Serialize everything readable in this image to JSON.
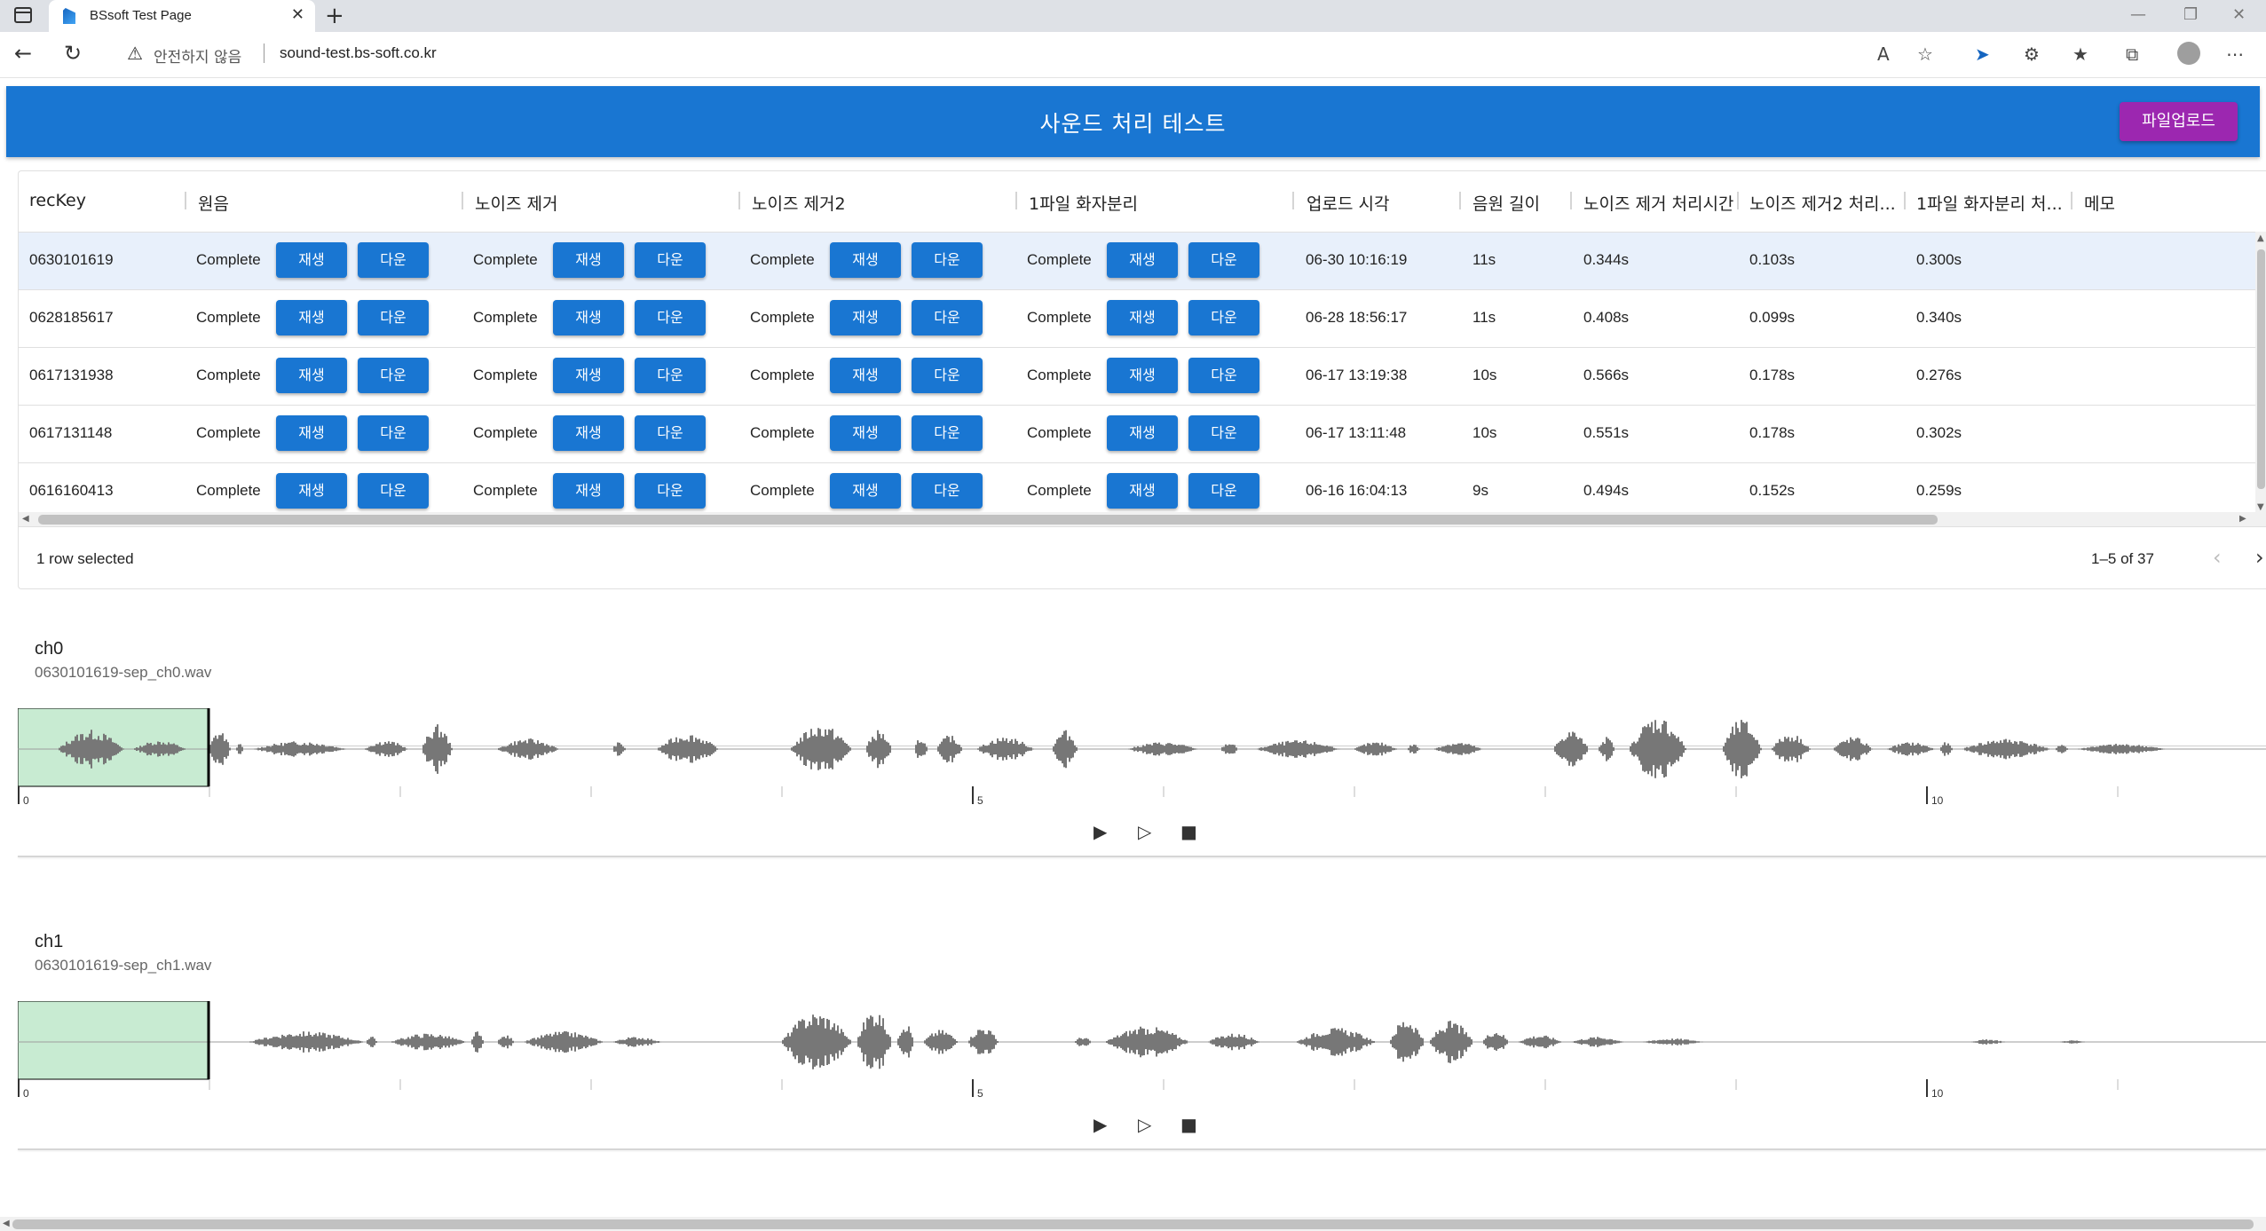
{
  "browser": {
    "tab_title": "BSsoft Test Page",
    "not_secure": "안전하지 않음",
    "url": "sound-test.bs-soft.co.kr"
  },
  "header": {
    "title": "사운드 처리 테스트",
    "upload_label": "파일업로드",
    "brand_color": "#1976d2",
    "upload_color": "#9c27b0"
  },
  "grid": {
    "columns": [
      "recKey",
      "원음",
      "노이즈 제거",
      "노이즈 제거2",
      "1파일 화자분리",
      "업로드 시각",
      "음원 길이",
      "노이즈 제거 처리시간",
      "노이즈 제거2 처리...",
      "1파일 화자분리 처...",
      "메모"
    ],
    "play_label": "재생",
    "down_label": "다운",
    "rows": [
      {
        "recKey": "0630101619",
        "orig": "Complete",
        "nr": "Complete",
        "nr2": "Complete",
        "sep": "Complete",
        "uploaded": "06-30 10:16:19",
        "length": "11s",
        "nr_time": "0.344s",
        "nr2_time": "0.103s",
        "sep_time": "0.300s",
        "memo": ""
      },
      {
        "recKey": "0628185617",
        "orig": "Complete",
        "nr": "Complete",
        "nr2": "Complete",
        "sep": "Complete",
        "uploaded": "06-28 18:56:17",
        "length": "11s",
        "nr_time": "0.408s",
        "nr2_time": "0.099s",
        "sep_time": "0.340s",
        "memo": ""
      },
      {
        "recKey": "0617131938",
        "orig": "Complete",
        "nr": "Complete",
        "nr2": "Complete",
        "sep": "Complete",
        "uploaded": "06-17 13:19:38",
        "length": "10s",
        "nr_time": "0.566s",
        "nr2_time": "0.178s",
        "sep_time": "0.276s",
        "memo": ""
      },
      {
        "recKey": "0617131148",
        "orig": "Complete",
        "nr": "Complete",
        "nr2": "Complete",
        "sep": "Complete",
        "uploaded": "06-17 13:11:48",
        "length": "10s",
        "nr_time": "0.551s",
        "nr2_time": "0.178s",
        "sep_time": "0.302s",
        "memo": ""
      },
      {
        "recKey": "0616160413",
        "orig": "Complete",
        "nr": "Complete",
        "nr2": "Complete",
        "sep": "Complete",
        "uploaded": "06-16 16:04:13",
        "length": "9s",
        "nr_time": "0.494s",
        "nr2_time": "0.152s",
        "sep_time": "0.259s",
        "memo": ""
      }
    ],
    "selection_text": "1 row selected",
    "pagination_text": "1–5 of 37"
  },
  "players": [
    {
      "title": "ch0",
      "file": "0630101619-sep_ch0.wav",
      "tick_labels": [
        "0",
        "5",
        "10"
      ],
      "selected_region_seconds": [
        0,
        1.0
      ]
    },
    {
      "title": "ch1",
      "file": "0630101619-sep_ch1.wav",
      "tick_labels": [
        "0",
        "5",
        "10"
      ],
      "selected_region_seconds": [
        0,
        1.0
      ]
    }
  ],
  "icons": {
    "play": "play-icon",
    "play_region": "play-outline-icon",
    "stop": "stop-icon"
  }
}
